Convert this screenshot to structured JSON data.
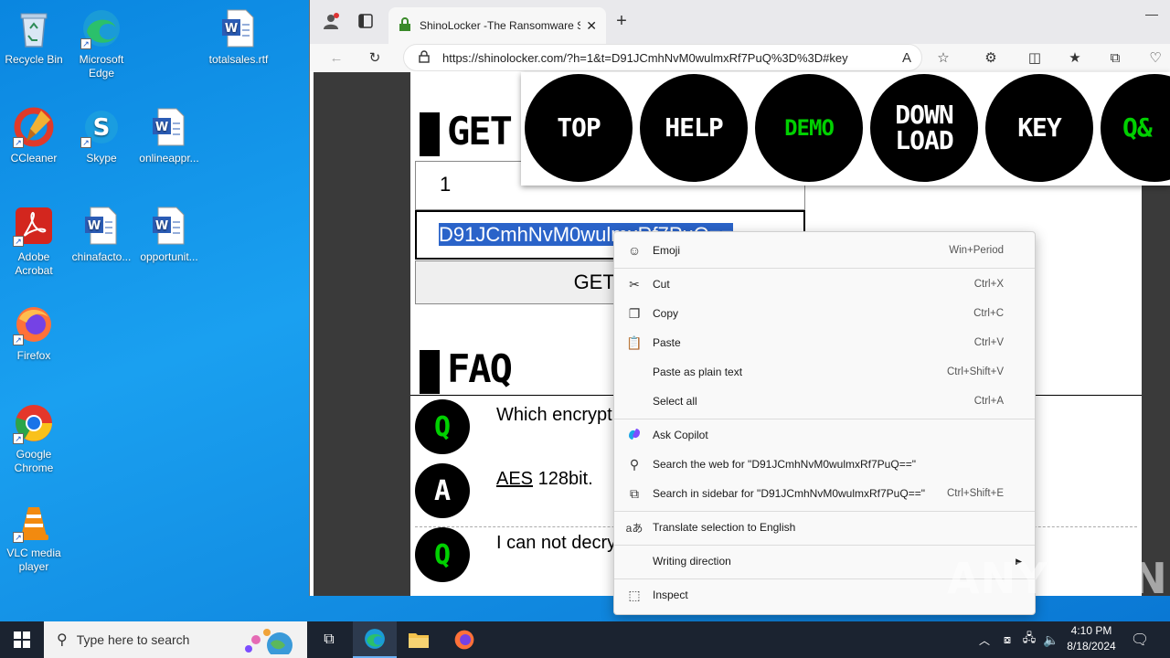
{
  "desktop": {
    "icons": [
      {
        "label": "Recycle Bin",
        "icon": "recycle-bin-icon"
      },
      {
        "label": "Microsoft Edge",
        "icon": "edge-icon"
      },
      {
        "label": "totalsales.rtf",
        "icon": "word-doc-icon"
      },
      {
        "label": "CCleaner",
        "icon": "ccleaner-icon"
      },
      {
        "label": "Skype",
        "icon": "skype-icon"
      },
      {
        "label": "onlineappr...",
        "icon": "word-doc-icon"
      },
      {
        "label": "Adobe Acrobat",
        "icon": "acrobat-icon"
      },
      {
        "label": "chinafacto...",
        "icon": "word-doc-icon"
      },
      {
        "label": "opportunit...",
        "icon": "word-doc-icon"
      },
      {
        "label": "Firefox",
        "icon": "firefox-icon"
      },
      {
        "label": "Google Chrome",
        "icon": "chrome-icon"
      },
      {
        "label": "VLC media player",
        "icon": "vlc-icon"
      }
    ]
  },
  "browser": {
    "tab_title": "ShinoLocker -The Ransomware S",
    "url": "https://shinolocker.com/?h=1&t=D91JCmhNvM0wulmxRf7PuQ%3D%3D#key",
    "page": {
      "get_heading": "GET",
      "nav_circles": [
        {
          "line1": "TOP",
          "line2": ""
        },
        {
          "line1": "HELP",
          "line2": ""
        },
        {
          "line1": "DEMO",
          "line2": ""
        },
        {
          "line1": "DOWN",
          "line2": "LOAD"
        },
        {
          "line1": "KEY",
          "line2": ""
        },
        {
          "line1": "Q&",
          "line2": ""
        }
      ],
      "id_value": "1",
      "key_value": "D91JCmhNvM0wulmxRf7PuQ==",
      "get_button": "GET TH",
      "faq_heading": "FAQ",
      "faq_items": [
        {
          "badge": "Q",
          "text": "Which encrypt"
        },
        {
          "badge": "A",
          "text_link": "AES",
          "text": " 128bit."
        },
        {
          "badge": "Q",
          "text": "I can not decry"
        }
      ]
    }
  },
  "context_menu": {
    "items": [
      {
        "label": "Emoji",
        "shortcut": "Win+Period",
        "icon": "emoji-icon"
      },
      {
        "label": "Cut",
        "shortcut": "Ctrl+X",
        "icon": "cut-icon"
      },
      {
        "label": "Copy",
        "shortcut": "Ctrl+C",
        "icon": "copy-icon"
      },
      {
        "label": "Paste",
        "shortcut": "Ctrl+V",
        "icon": "paste-icon"
      },
      {
        "label": "Paste as plain text",
        "shortcut": "Ctrl+Shift+V",
        "icon": ""
      },
      {
        "label": "Select all",
        "shortcut": "Ctrl+A",
        "icon": ""
      },
      {
        "label": "Ask Copilot",
        "shortcut": "",
        "icon": "copilot-icon"
      },
      {
        "label": "Search the web for \"D91JCmhNvM0wulmxRf7PuQ==\"",
        "shortcut": "",
        "icon": "search-icon"
      },
      {
        "label": "Search in sidebar for \"D91JCmhNvM0wulmxRf7PuQ==\"",
        "shortcut": "Ctrl+Shift+E",
        "icon": "sidebar-search-icon"
      },
      {
        "label": "Translate selection to English",
        "shortcut": "",
        "icon": "translate-icon"
      },
      {
        "label": "Writing direction",
        "shortcut": "",
        "icon": ""
      },
      {
        "label": "Inspect",
        "shortcut": "",
        "icon": "inspect-icon"
      }
    ]
  },
  "watermark": "ANY RUN",
  "taskbar": {
    "search_placeholder": "Type here to search",
    "time": "4:10 PM",
    "date": "8/18/2024"
  },
  "colors": {
    "accent_green": "#00d000",
    "selection": "#2a63c9"
  }
}
